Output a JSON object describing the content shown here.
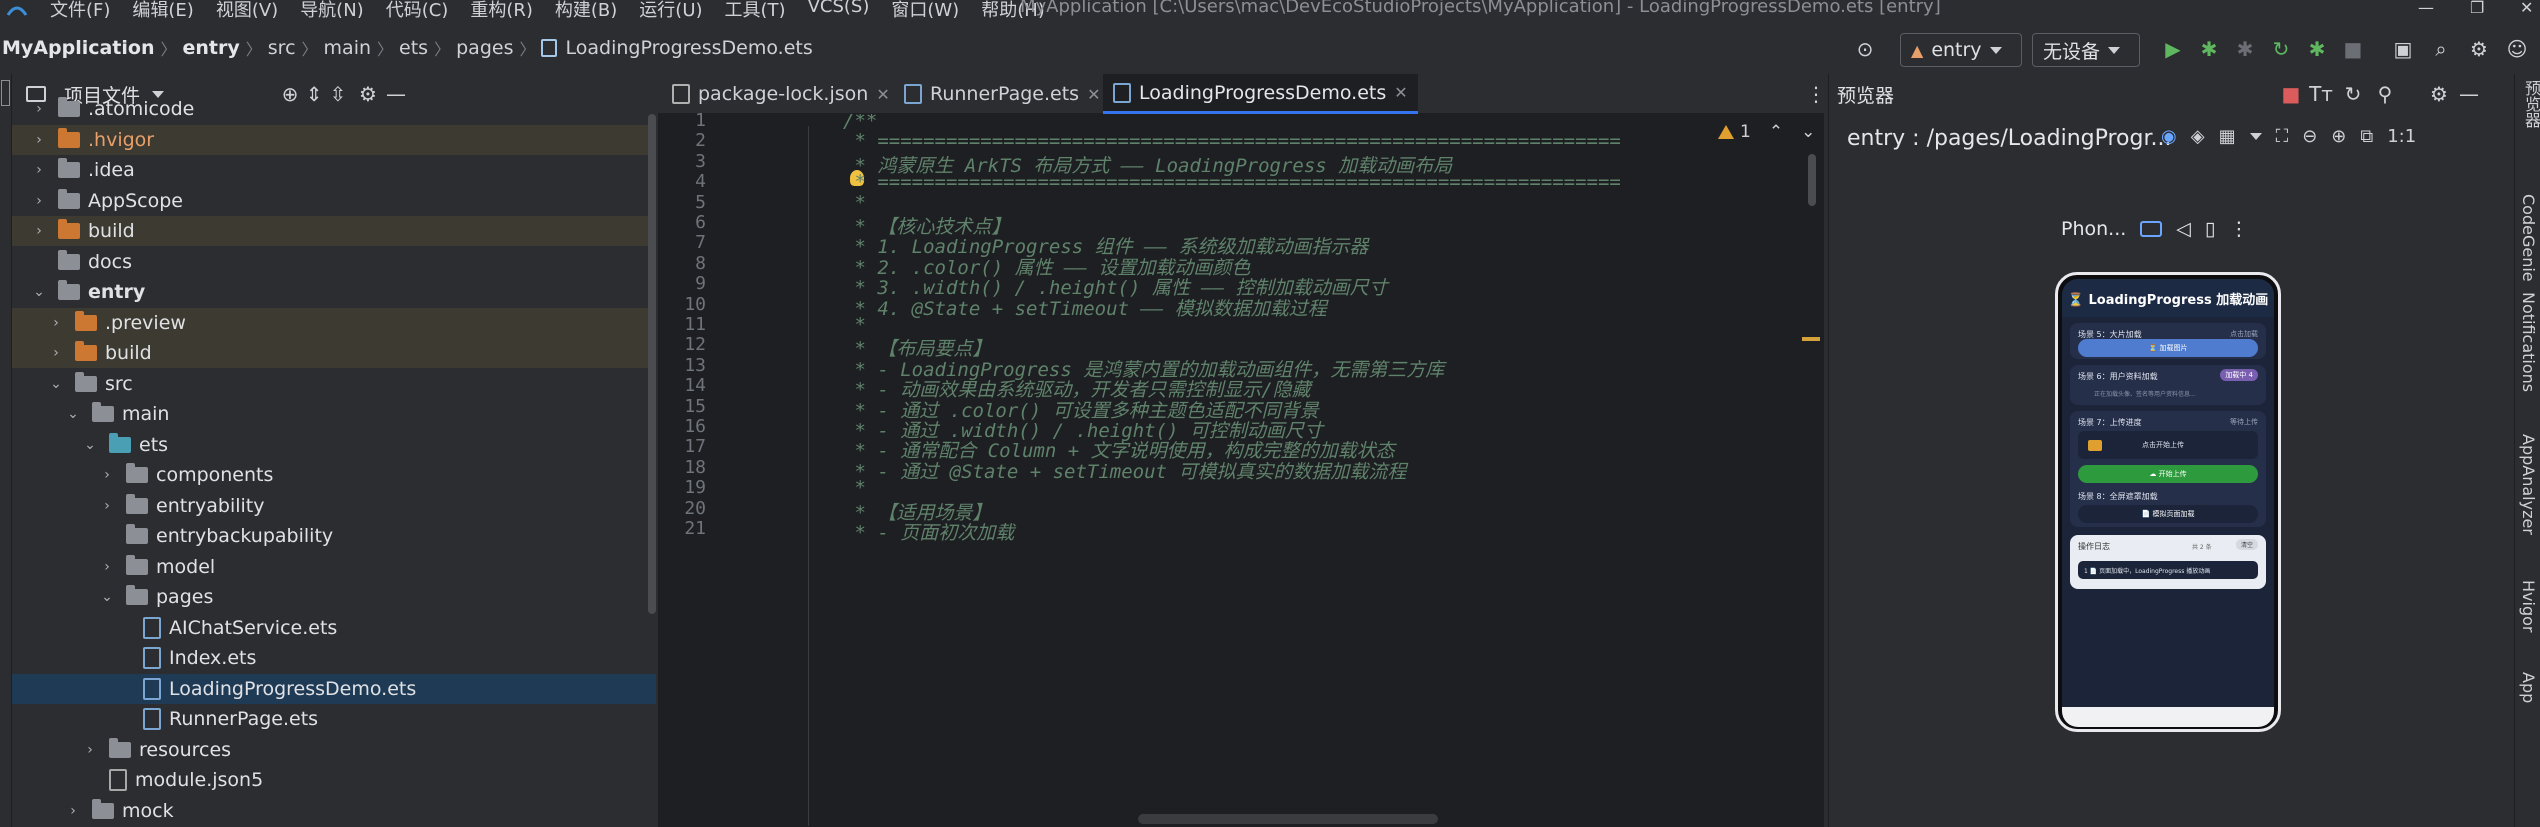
{
  "menubar": {
    "items": [
      "文件(F)",
      "编辑(E)",
      "视图(V)",
      "导航(N)",
      "代码(C)",
      "重构(R)",
      "构建(B)",
      "运行(U)",
      "工具(T)",
      "VCS(S)",
      "窗口(W)",
      "帮助(H)"
    ],
    "window_title": "MyApplication [C:\\Users\\mac\\DevEcoStudioProjects\\MyApplication] - LoadingProgressDemo.ets [entry]"
  },
  "navbar": {
    "crumbs": [
      "MyApplication",
      "entry",
      "src",
      "main",
      "ets",
      "pages",
      "LoadingProgressDemo.ets"
    ],
    "run_config": "entry",
    "device": "无设备"
  },
  "project": {
    "title": "项目文件",
    "tree": [
      {
        "label": ".atomicode",
        "indent": 0,
        "type": "folder-gray",
        "chev": "›",
        "excluded": false
      },
      {
        "label": ".hvigor",
        "indent": 0,
        "type": "folder-orange",
        "chev": "›",
        "excluded": true,
        "orange": true
      },
      {
        "label": ".idea",
        "indent": 0,
        "type": "folder-gray",
        "chev": "›",
        "excluded": false
      },
      {
        "label": "AppScope",
        "indent": 0,
        "type": "folder-gray",
        "chev": "›",
        "excluded": false
      },
      {
        "label": "build",
        "indent": 0,
        "type": "folder-orange",
        "chev": "›",
        "excluded": true
      },
      {
        "label": "docs",
        "indent": 0,
        "type": "folder-gray",
        "chev": "",
        "excluded": false
      },
      {
        "label": "entry",
        "indent": 0,
        "type": "folder-gray",
        "chev": "⌄",
        "excluded": false,
        "bold": true
      },
      {
        "label": ".preview",
        "indent": 1,
        "type": "folder-orange",
        "chev": "›",
        "excluded": true
      },
      {
        "label": "build",
        "indent": 1,
        "type": "folder-orange",
        "chev": "›",
        "excluded": true
      },
      {
        "label": "src",
        "indent": 1,
        "type": "folder-gray",
        "chev": "⌄",
        "excluded": false
      },
      {
        "label": "main",
        "indent": 2,
        "type": "folder-gray",
        "chev": "⌄",
        "excluded": false
      },
      {
        "label": "ets",
        "indent": 3,
        "type": "folder-teal",
        "chev": "⌄",
        "excluded": false
      },
      {
        "label": "components",
        "indent": 4,
        "type": "folder-gray",
        "chev": "›",
        "excluded": false
      },
      {
        "label": "entryability",
        "indent": 4,
        "type": "folder-gray",
        "chev": "›",
        "excluded": false
      },
      {
        "label": "entrybackupability",
        "indent": 4,
        "type": "folder-gray",
        "chev": "",
        "excluded": false
      },
      {
        "label": "model",
        "indent": 4,
        "type": "folder-gray",
        "chev": "›",
        "excluded": false
      },
      {
        "label": "pages",
        "indent": 4,
        "type": "folder-gray",
        "chev": "⌄",
        "excluded": false
      },
      {
        "label": "AIChatService.ets",
        "indent": 5,
        "type": "file",
        "chev": "",
        "excluded": false
      },
      {
        "label": "Index.ets",
        "indent": 5,
        "type": "file",
        "chev": "",
        "excluded": false
      },
      {
        "label": "LoadingProgressDemo.ets",
        "indent": 5,
        "type": "file",
        "chev": "",
        "excluded": false,
        "selected": true
      },
      {
        "label": "RunnerPage.ets",
        "indent": 5,
        "type": "file",
        "chev": "",
        "excluded": false
      },
      {
        "label": "resources",
        "indent": 3,
        "type": "folder-gray",
        "chev": "›",
        "excluded": false
      },
      {
        "label": "module.json5",
        "indent": 3,
        "type": "file-json",
        "chev": "",
        "excluded": false
      },
      {
        "label": "mock",
        "indent": 2,
        "type": "folder-gray",
        "chev": "›",
        "excluded": false
      }
    ]
  },
  "editor": {
    "tabs": [
      {
        "label": "package-lock.json",
        "icon": "json"
      },
      {
        "label": "RunnerPage.ets",
        "icon": "ets"
      },
      {
        "label": "LoadingProgressDemo.ets",
        "icon": "ets",
        "active": true
      }
    ],
    "warning_count": "1",
    "lines": [
      {
        "no": "1",
        "text": "/**"
      },
      {
        "no": "2",
        "text": " * ================================================================="
      },
      {
        "no": "3",
        "text": " * 鸿蒙原生 ArkTS 布局方式 —— LoadingProgress 加载动画布局"
      },
      {
        "no": "4",
        "text": " * ================================================================="
      },
      {
        "no": "5",
        "text": " *"
      },
      {
        "no": "6",
        "text": " * 【核心技术点】"
      },
      {
        "no": "7",
        "text": " * 1. LoadingProgress 组件 —— 系统级加载动画指示器"
      },
      {
        "no": "8",
        "text": " * 2. .color() 属性 —— 设置加载动画颜色"
      },
      {
        "no": "9",
        "text": " * 3. .width() / .height() 属性 —— 控制加载动画尺寸"
      },
      {
        "no": "10",
        "text": " * 4. @State + setTimeout —— 模拟数据加载过程"
      },
      {
        "no": "11",
        "text": " *"
      },
      {
        "no": "12",
        "text": " * 【布局要点】"
      },
      {
        "no": "13",
        "text": " * - LoadingProgress 是鸿蒙内置的加载动画组件，无需第三方库"
      },
      {
        "no": "14",
        "text": " * - 动画效果由系统驱动，开发者只需控制显示/隐藏"
      },
      {
        "no": "15",
        "text": " * - 通过 .color() 可设置多种主题色适配不同背景"
      },
      {
        "no": "16",
        "text": " * - 通过 .width() / .height() 可控制动画尺寸"
      },
      {
        "no": "17",
        "text": " * - 通常配合 Column + 文字说明使用，构成完整的加载状态"
      },
      {
        "no": "18",
        "text": " * - 通过 @State + setTimeout 可模拟真实的数据加载流程"
      },
      {
        "no": "19",
        "text": " *"
      },
      {
        "no": "20",
        "text": " * 【适用场景】"
      },
      {
        "no": "21",
        "text": " * - 页面初次加载"
      }
    ]
  },
  "preview": {
    "title": "预览器",
    "path": "entry : /pages/LoadingProgr...",
    "device": "Phon...",
    "phone": {
      "title": "⏳ LoadingProgress 加载动画",
      "card1_title": "场景 5：大片加载",
      "card1_right": "点击加载",
      "card1_button": "⏳ 加载图片",
      "card2_title": "场景 6：用户资料加载",
      "card2_badge": "加载中 4",
      "card2_text": "正在加载头像、签名等用户资料信息...",
      "card3_title": "场景 7：上传进度",
      "card3_right": "等待上传",
      "card3_box": "点击开始上传",
      "card3_button": "☁ 开始上传",
      "card4_title": "场景 8：全屏遮罩加载",
      "card4_button": "📄 模拟页面加载",
      "log_title": "操作日志",
      "log_count": "共 2 条",
      "log_clear": "清空",
      "log_entry": "1  📄 页面加载中，LoadingProgress 播放动画"
    }
  },
  "right_sidebar": {
    "tabs": [
      "预览器",
      "CodeGenie",
      "Notifications",
      "AppAnalyzer",
      "Hvigor",
      "App"
    ]
  },
  "colors": {
    "accent": "#3574f0",
    "comment": "#5f826b",
    "excluded_bg": "#3d3b31",
    "selected_bg": "#1f3a54",
    "run_green": "#5fb85f",
    "stop_red": "#db5c5c"
  }
}
